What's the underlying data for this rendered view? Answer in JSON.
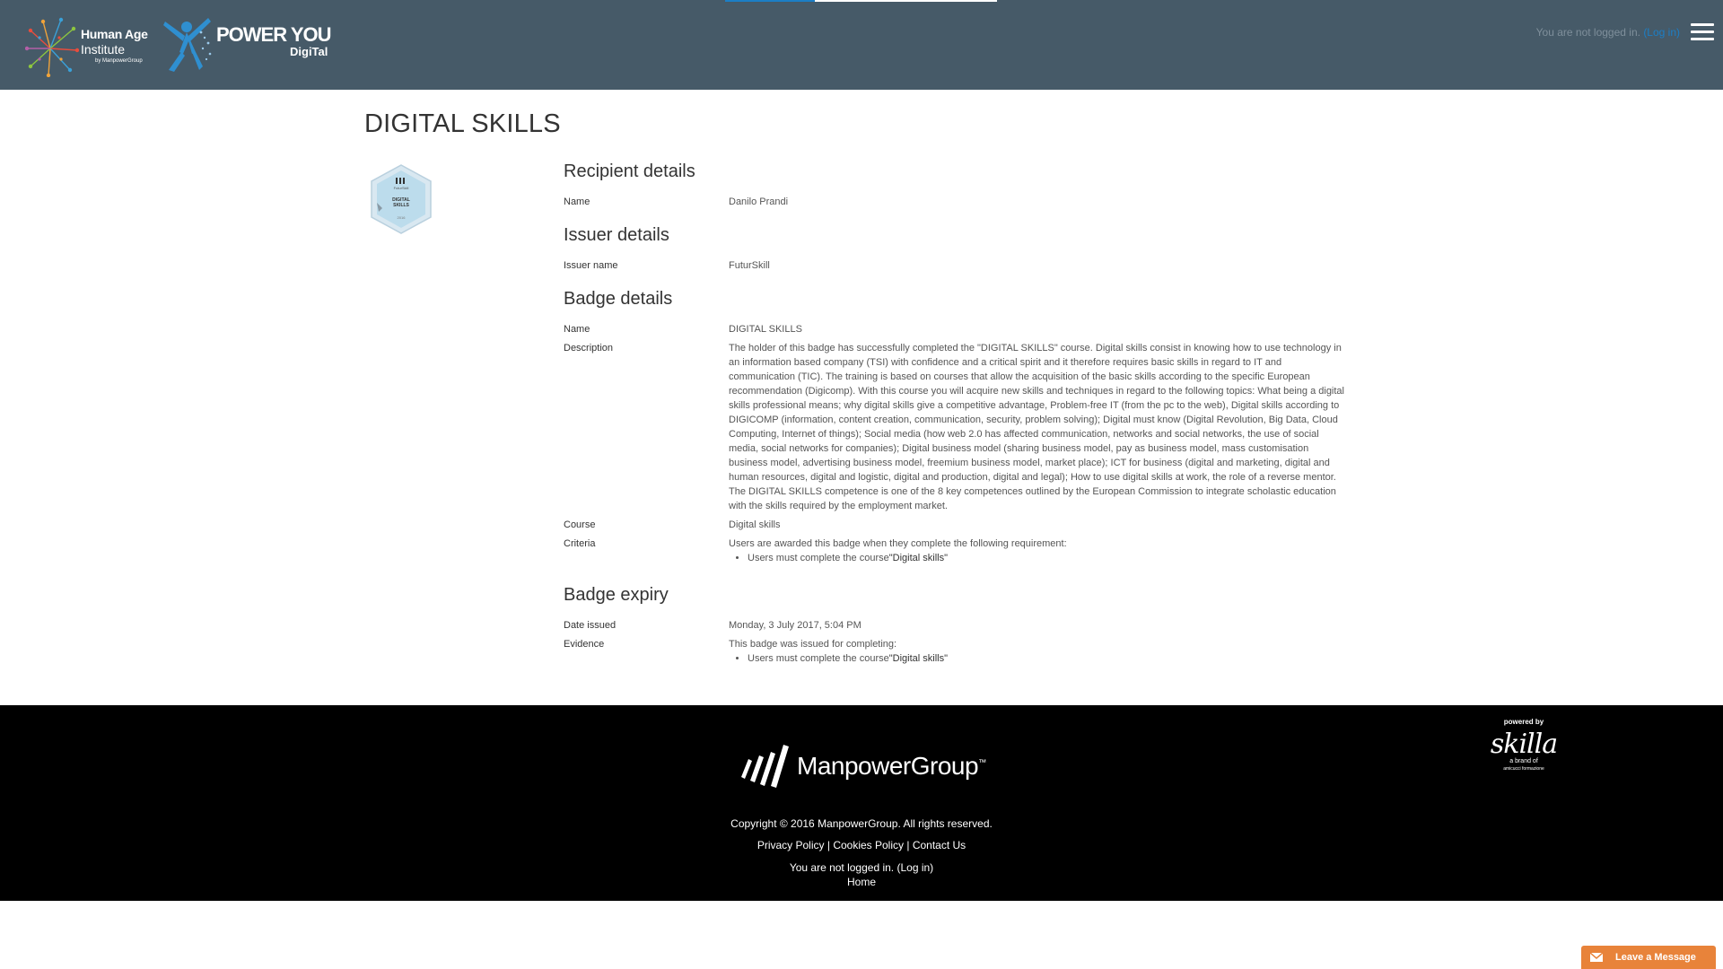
{
  "header": {
    "hai_logo": {
      "line1": "Human Age",
      "line2": "Institute",
      "line3": "by ManpowerGroup"
    },
    "powerup_logo": {
      "line1": "POWER YOU",
      "line2": "DigiTal"
    },
    "login_status_prefix": "You are not logged in.",
    "login_link": "(Log in)",
    "top_progress": 0.33,
    "accent_color": "#1c7ec5",
    "bar_color": "#465a68"
  },
  "page": {
    "title": "DIGITAL SKILLS",
    "badge_text": {
      "brand": "FuturSkill",
      "name_line1": "DIGITAL",
      "name_line2": "SKILLS",
      "year": "2016"
    }
  },
  "recipient": {
    "heading": "Recipient details",
    "name_label": "Name",
    "name_value": "Danilo Prandi"
  },
  "issuer": {
    "heading": "Issuer details",
    "name_label": "Issuer name",
    "name_value": "FuturSkill"
  },
  "badge": {
    "heading": "Badge details",
    "name_label": "Name",
    "name_value": "DIGITAL SKILLS",
    "description_label": "Description",
    "description_value": "The holder of this badge has successfully completed the \"DIGITAL SKILLS\" course. Digital skills consist in knowing how to use technology in an information based company (TSI) with confidence and a critical spirit and it therefore requires basic skills in regard to IT and communication (TIC). The training is based on courses that allow the acquisition of the basic skills according to the specific European recommendation (Digicomp). With this course you will acquire new skills and techniques in regard to the following topics: What being a digital skills professional means; why digital skills give a competitive advantage, Problem-free IT (from the pc to the web), Digital skills according to DIGICOMP (information, content creation, communication, security, problem solving); Digital must know (Digital Revolution, Big Data, Cloud Computing, Internet of things); Social media (how web 2.0 has affected communication, networks and social networks, the use of social media, social networks for companies); Digital business model (sharing business model, pay as business model, mass customisation business model, advertising business model, freemium business model, market place); ICT for business (digital and marketing, digital and human resources, digital and logistic, digital and production, digital and legal); How to use digital skills at work, the role of a reverse mentor. The DIGITAL SKILLS competence is one of the 8 key competences outlined by the European Commission to integrate scholastic education with the skills required by the employment market.",
    "course_label": "Course",
    "course_value": "Digital skills",
    "criteria_label": "Criteria",
    "criteria_intro": "Users are awarded this badge when they complete the following requirement:",
    "criteria_item_prefix": "Users must complete the course",
    "criteria_item_course": "\"Digital skills\""
  },
  "expiry": {
    "heading": "Badge expiry",
    "date_label": "Date issued",
    "date_value": "Monday, 3 July 2017, 5:04 PM",
    "evidence_label": "Evidence",
    "evidence_intro": "This badge was issued for completing:",
    "evidence_item_prefix": "Users must complete the course",
    "evidence_item_course": "\"Digital skills\""
  },
  "footer": {
    "brand": "ManpowerGroup",
    "trademark": "™",
    "copyright": "Copyright © 2016 ManpowerGroup. All rights reserved.",
    "privacy": "Privacy Policy",
    "cookies": "Cookies Policy",
    "contact": "Contact Us",
    "separator": "|",
    "login_prefix": "You are not logged in.",
    "login_link": "(Log in)",
    "home": "Home",
    "powered_by": "powered by",
    "skilla_name": "skilla",
    "skilla_sub1": "a brand of",
    "skilla_sub2": "amicucci formazione"
  },
  "chat": {
    "label": "Leave a Message",
    "color": "#e8833a"
  }
}
